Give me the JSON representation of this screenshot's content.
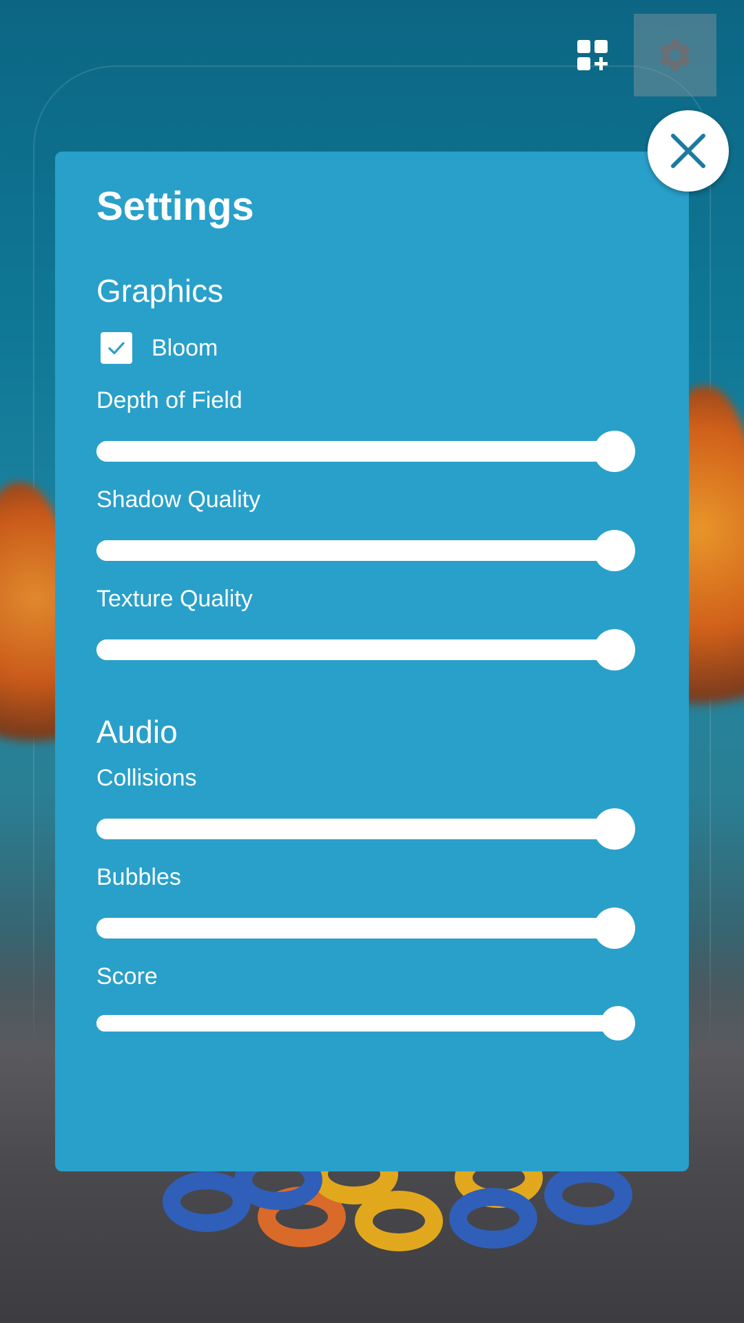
{
  "settings": {
    "title": "Settings",
    "graphics": {
      "heading": "Graphics",
      "bloom": {
        "label": "Bloom",
        "checked": true
      },
      "sliders": [
        {
          "label": "Depth of Field",
          "value": 1.0
        },
        {
          "label": "Shadow Quality",
          "value": 1.0
        },
        {
          "label": "Texture Quality",
          "value": 1.0
        }
      ]
    },
    "audio": {
      "heading": "Audio",
      "sliders": [
        {
          "label": "Collisions",
          "value": 1.0
        },
        {
          "label": "Bubbles",
          "value": 1.0
        },
        {
          "label": "Score",
          "value": 1.0
        }
      ]
    }
  },
  "toolbar": {
    "widgets_icon": "dashboard-add-icon",
    "settings_icon": "gear-icon",
    "close_icon": "close-icon"
  },
  "colors": {
    "panel": "#29a0ca",
    "close_icon": "#1d7aa0",
    "gear": "#6b6e73"
  }
}
